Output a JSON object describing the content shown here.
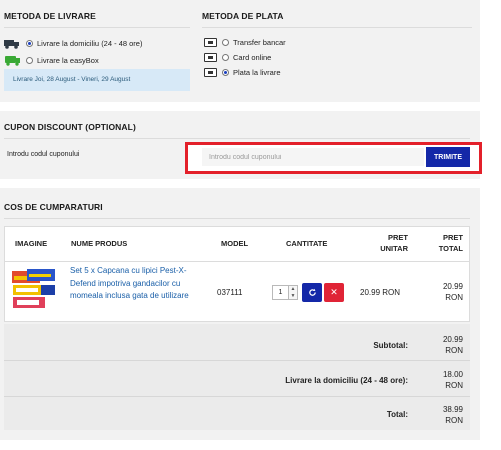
{
  "shipping": {
    "heading": "METODA DE LIVRARE",
    "options": [
      {
        "label": "Livrare la domiciliu (24 - 48 ore)",
        "selected": true,
        "icon": "truck-icon"
      },
      {
        "label": "Livrare la easyBox",
        "selected": false,
        "icon": "easybox-icon"
      }
    ],
    "note": "Livrare Joi, 28 August - Vineri, 29 August"
  },
  "payment": {
    "heading": "METODA DE PLATA",
    "options": [
      {
        "label": "Transfer bancar",
        "selected": false,
        "icon": "bank-transfer-icon"
      },
      {
        "label": "Card online",
        "selected": false,
        "icon": "credit-card-icon"
      },
      {
        "label": "Plata la livrare",
        "selected": true,
        "icon": "cash-icon"
      }
    ]
  },
  "coupon": {
    "heading": "CUPON DISCOUNT (OPTIONAL)",
    "label": "Introdu codul cuponului",
    "placeholder": "Introdu codul cuponului",
    "value": "",
    "button": "TRIMITE",
    "highlight_color": "#e3202a"
  },
  "cart": {
    "heading": "COS DE CUMPARATURI",
    "columns": {
      "image": "IMAGINE",
      "name": "NUME PRODUS",
      "model": "MODEL",
      "qty": "CANTITATE",
      "unit_price_1": "PRET",
      "unit_price_2": "UNITAR",
      "total_1": "PRET",
      "total_2": "TOTAL"
    },
    "items": [
      {
        "name": "Set 5 x Capcana cu lipici Pest-X-Defend impotriva gandacilor cu momeala inclusa gata de utilizare",
        "model": "037111",
        "qty": "1",
        "unit_price": "20.99 RON",
        "total_1": "20.99",
        "total_2": "RON"
      }
    ],
    "totals": [
      {
        "label": "Subtotal:",
        "value_1": "20.99",
        "value_2": "RON"
      },
      {
        "label": "Livrare la domiciliu (24 - 48 ore):",
        "value_1": "18.00",
        "value_2": "RON"
      },
      {
        "label": "Total:",
        "value_1": "38.99",
        "value_2": "RON"
      }
    ]
  },
  "colors": {
    "primary_button": "#1428a8",
    "danger_button": "#e02436",
    "link": "#1a5fa8",
    "panel_bg": "#f2f2f2"
  }
}
